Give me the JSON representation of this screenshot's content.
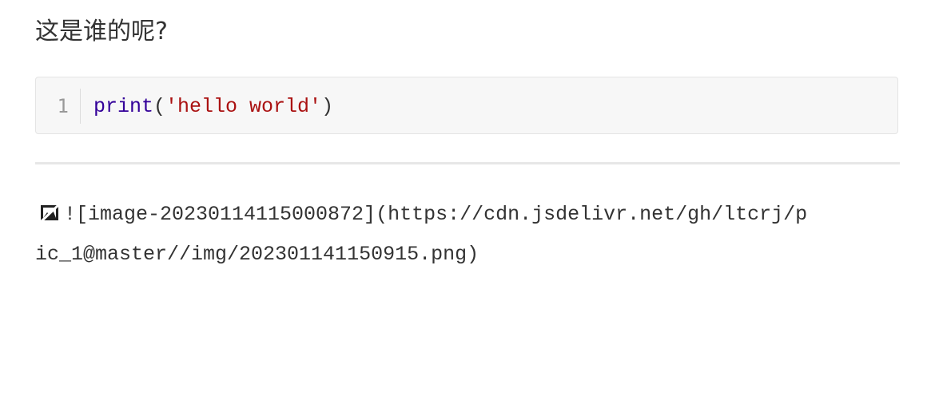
{
  "heading": {
    "text": "这是谁的呢?"
  },
  "code_block": {
    "line_number": "1",
    "tokens": {
      "builtin": "print",
      "open_paren": "(",
      "string": "'hello world'",
      "close_paren": ")"
    }
  },
  "image_markup": {
    "icon": "broken-image-icon",
    "line1": "![image-20230114115000872](https://cdn.jsdelivr.net/gh/ltcrj/p",
    "line2": "ic_1@master//img/202301141150915.png)"
  },
  "colors": {
    "code_background": "#f7f7f7",
    "builtin": "#330099",
    "string": "#aa1111",
    "line_number": "#999999",
    "divider": "#e7e7e7"
  }
}
